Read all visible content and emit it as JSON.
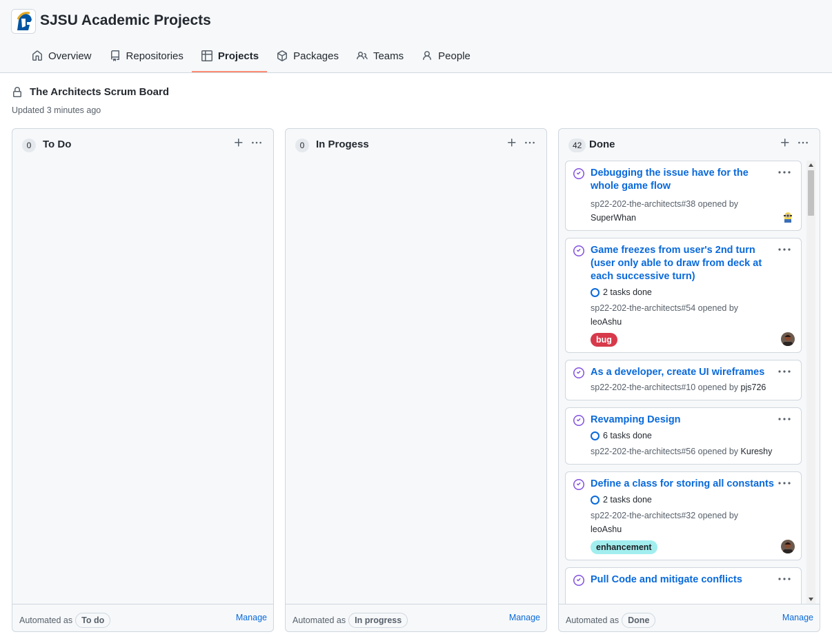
{
  "org": {
    "name": "SJSU Academic Projects",
    "logo_icon": "spartan-helmet-logo"
  },
  "nav": [
    {
      "label": "Overview",
      "icon": "home-icon",
      "active": false
    },
    {
      "label": "Repositories",
      "icon": "repo-icon",
      "active": false
    },
    {
      "label": "Projects",
      "icon": "table-icon",
      "active": true
    },
    {
      "label": "Packages",
      "icon": "package-icon",
      "active": false
    },
    {
      "label": "Teams",
      "icon": "people-icon",
      "active": false
    },
    {
      "label": "People",
      "icon": "person-icon",
      "active": false
    }
  ],
  "board": {
    "title": "The Architects Scrum Board",
    "updated": "Updated 3 minutes ago",
    "lock_icon": "lock-icon"
  },
  "columns": [
    {
      "count": "0",
      "name": "To Do",
      "automated_prefix": "Automated as",
      "automated_value": "To do",
      "manage": "Manage",
      "cards": []
    },
    {
      "count": "0",
      "name": "In Progess",
      "automated_prefix": "Automated as",
      "automated_value": "In progress",
      "manage": "Manage",
      "cards": []
    },
    {
      "count": "42",
      "name": "Done",
      "automated_prefix": "Automated as",
      "automated_value": "Done",
      "manage": "Manage",
      "cards": [
        {
          "title": "Debugging the issue have for the whole game flow",
          "ref": "sp22-202-the-architects#38 opened by",
          "author": "SuperWhan",
          "tasks": "",
          "label": "",
          "avatar": "minion"
        },
        {
          "title": "Game freezes from user's 2nd turn (user only able to draw from deck at each successive turn)",
          "ref": "sp22-202-the-architects#54 opened by",
          "author": "leoAshu",
          "tasks": "2 tasks done",
          "label": "bug",
          "avatar": "person"
        },
        {
          "title": "As a developer, create UI wireframes",
          "ref": "sp22-202-the-architects#10 opened by",
          "author": "pjs726",
          "tasks": "",
          "label": "",
          "avatar": ""
        },
        {
          "title": "Revamping Design",
          "ref": "sp22-202-the-architects#56 opened by",
          "author": "Kureshy",
          "tasks": "6 tasks done",
          "label": "",
          "avatar": ""
        },
        {
          "title": "Define a class for storing all constants",
          "ref": "sp22-202-the-architects#32 opened by",
          "author": "leoAshu",
          "tasks": "2 tasks done",
          "label": "enhancement",
          "avatar": "person"
        },
        {
          "title": "Pull Code and mitigate conflicts",
          "ref": "",
          "author": "",
          "tasks": "",
          "label": "",
          "avatar": ""
        }
      ]
    }
  ],
  "colors": {
    "link": "#0969da",
    "closed_issue": "#8250df",
    "nav_underline": "#fd8c73",
    "label_bug": "#d73a4a",
    "label_enhancement": "#a2eeef"
  }
}
